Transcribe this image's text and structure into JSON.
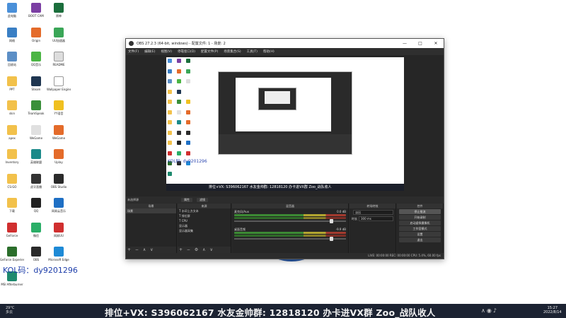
{
  "desktop": {
    "kol_text": "KOL码：dy9201296",
    "icons": [
      {
        "label": "此电脑",
        "color": "#4a90d9"
      },
      {
        "label": "BOOT CAM",
        "color": "#7b3fa3"
      },
      {
        "label": "原神",
        "color": "#1b6e3c"
      },
      {
        "label": "网络",
        "color": "#3a7fc4"
      },
      {
        "label": "Origin",
        "color": "#e46b2a"
      },
      {
        "label": "UU加速器",
        "color": "#3aa657"
      },
      {
        "label": "回收站",
        "color": "#5c8fc6"
      },
      {
        "label": "QQ音乐",
        "color": "#4bb544"
      },
      {
        "label": "README",
        "color": "#dddddd"
      },
      {
        "label": "PPT",
        "color": "#f2c14b"
      },
      {
        "label": "Steam",
        "color": "#1e3550"
      },
      {
        "label": "Wallpaper Engine",
        "color": "#ffffff"
      },
      {
        "label": "skin",
        "color": "#f2c14b"
      },
      {
        "label": "TeamSpeak",
        "color": "#3a8f3a"
      },
      {
        "label": "YY语音",
        "color": "#f0c020"
      },
      {
        "label": "apex",
        "color": "#f2c14b"
      },
      {
        "label": "WeGame",
        "color": "#e0e0e0"
      },
      {
        "label": "WeGame",
        "color": "#e46b2a"
      },
      {
        "label": "Inventory",
        "color": "#f2c14b"
      },
      {
        "label": "英雄联盟",
        "color": "#1b8a8a"
      },
      {
        "label": "Uplay",
        "color": "#e46b2a"
      },
      {
        "label": "CS:GO",
        "color": "#f2c14b"
      },
      {
        "label": "虎牙直播",
        "color": "#333333"
      },
      {
        "label": "OBS Studio",
        "color": "#2a2a2a"
      },
      {
        "label": "下载",
        "color": "#f2c14b"
      },
      {
        "label": "QQ",
        "color": "#222222"
      },
      {
        "label": "网易云音乐",
        "color": "#1e6fc4"
      },
      {
        "label": "GeForce",
        "color": "#d02f2f"
      },
      {
        "label": "微信",
        "color": "#2aae67"
      },
      {
        "label": "网易UU",
        "color": "#d02f2f"
      },
      {
        "label": "GeForce Experience",
        "color": "#2b6e2b"
      },
      {
        "label": "OBS",
        "color": "#2a2a2a"
      },
      {
        "label": "Microsoft Edge",
        "color": "#1e8ad6"
      },
      {
        "label": "MSI Afterburner",
        "color": "#1e8a6e"
      }
    ]
  },
  "obs": {
    "title": "OBS 27.2.3 (64-bit, windows) - 配置文件: 1 - 场景: 2",
    "menu": [
      "文件(F)",
      "编辑(E)",
      "视图(V)",
      "停靠窗口(D)",
      "配置文件(P)",
      "场景集合(S)",
      "工具(T)",
      "帮助(H)"
    ],
    "preview": {
      "ticker": "排位+VX: S396062167 水友金帅群: 12818120 办卡进VX群 Zoo_战队收人",
      "kol_mini": "KOL码: dy9201296"
    },
    "scene_bar": {
      "label": "未选择源",
      "btn1": "属性",
      "btn2": "滤镜"
    },
    "docks": {
      "scenes": {
        "title": "场景",
        "items": [
          "场景"
        ]
      },
      "sources": {
        "title": "来源",
        "items": [
          "T 水印上方文本",
          "T 排位群",
          "T CPU",
          "显示器",
          "显示器采集"
        ]
      },
      "mixer": {
        "title": "混音器",
        "tracks": [
          {
            "name": "麦克风/Aux",
            "db": "0.0 dB"
          },
          {
            "name": "桌面音频",
            "db": "-9.9 dB"
          }
        ]
      },
      "transitions": {
        "title": "转场特效",
        "type": "淡出",
        "duration_label": "时长",
        "duration": "300 ms"
      },
      "controls": {
        "title": "控件",
        "buttons": [
          "停止推流",
          "开始录制",
          "启动虚拟摄像机",
          "工作室模式",
          "设置",
          "退出"
        ]
      }
    },
    "status": "LIVE: 00:00:00   REC: 00:00:00   CPU: 5.4%, 60.00 fps"
  },
  "taskbar": {
    "weather_temp": "29°C",
    "weather_text": "多云",
    "banner": "排位+VX: S396062167 水友金帅群: 12818120 办卡进VX群 Zoo_战队收人",
    "time": "15:27",
    "date": "2022/8/14"
  }
}
